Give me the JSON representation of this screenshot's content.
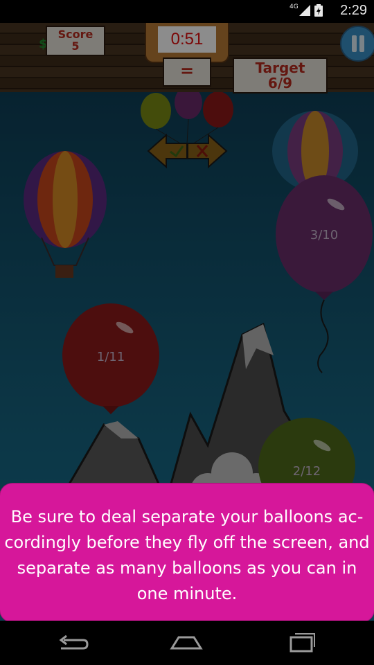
{
  "status_bar": {
    "network": "4G",
    "time": "2:29"
  },
  "hud": {
    "score_label": "Score",
    "score_value": "5",
    "currency_icon": "$",
    "timer": "0:51",
    "equals_sign": "=",
    "target_label": "Target",
    "target_value": "6/9"
  },
  "balloons": [
    {
      "label": "3/10",
      "color": "#6b2f6b"
    },
    {
      "label": "1/11",
      "color": "#8c1a1a"
    },
    {
      "label": "2/12",
      "color": "#4f6a1a"
    }
  ],
  "tutorial": {
    "text": "Be sure to deal separate your balloons ac-cordingly before they fly off the screen, and separate as many balloons as you can in one minute.",
    "background": "#d6179a"
  },
  "colors": {
    "sky": "#16627e",
    "timer_text": "#e01010",
    "panel_text": "#b72a1e"
  }
}
